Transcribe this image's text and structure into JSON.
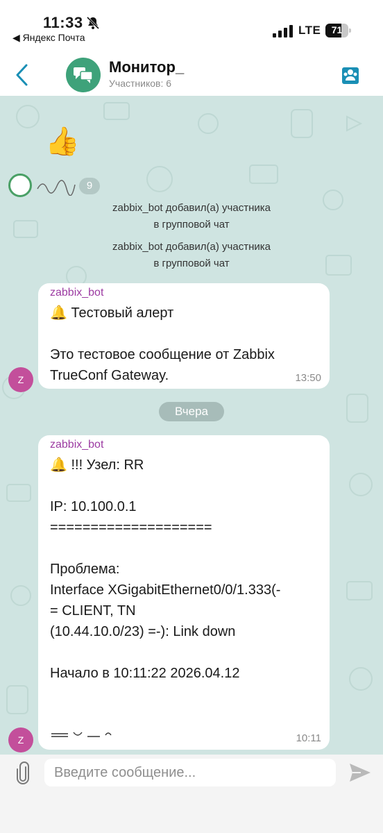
{
  "status_bar": {
    "time": "11:33",
    "back_app": "◀ Яндекс Почта",
    "network": "LTE",
    "battery": "71",
    "battery_level": 0.71
  },
  "header": {
    "title": "Монитор_",
    "subtitle": "Участников: 6"
  },
  "reaction": {
    "emoji": "👍",
    "count": "9"
  },
  "system_messages": [
    {
      "line1": "zabbix_bot добавил(а) участника",
      "line2": "в групповой чат"
    },
    {
      "line1": "zabbix_bot добавил(а) участника",
      "line2": "в групповой чат"
    }
  ],
  "messages": [
    {
      "sender": "zabbix_bot",
      "avatar_letter": "Z",
      "text": "🔔 Тестовый алерт\n\nЭто тестовое сообщение от Zabbix\nTrueConf Gateway.",
      "time": "13:50"
    },
    {
      "sender": "zabbix_bot",
      "avatar_letter": "Z",
      "text": "🔔 !!! Узел: RR\n\nIP: 10.100.0.1\n====================\n\nПроблема:\nInterface XGigabitEthernet0/0/1.333(-\n= CLIENT, TN\n(10.44.10.0/23) =-): Link down\n\nНачало в 10:11:22  2026.04.12",
      "time": "10:11"
    }
  ],
  "date_separator": "Вчера",
  "composer": {
    "placeholder": "Введите сообщение..."
  },
  "colors": {
    "accent": "#1a8fb5",
    "avatar_green": "#3ea27a",
    "sender_purple": "#9c3ba2",
    "chat_bg": "#cfe4e1"
  }
}
